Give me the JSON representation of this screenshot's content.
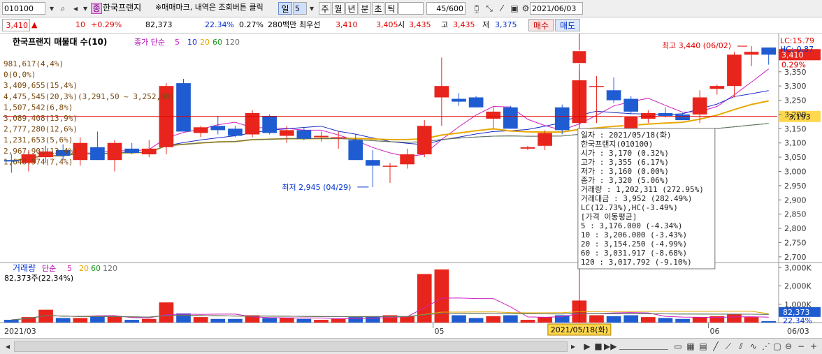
{
  "toolbar": {
    "code": "010100",
    "stock_name": "한국프랜지",
    "notice": "※매매마크, 내역은 조회버튼 클릭",
    "period_tabs": [
      "일",
      "주",
      "월",
      "년",
      "분",
      "초",
      "틱"
    ],
    "period_value": "5",
    "count_value": "45/600",
    "date_value": "2021/06/03"
  },
  "quote": {
    "price": "3,410",
    "change_arrow": "▲",
    "change": "10",
    "change_pct": "+0.29%",
    "volume": "82,373",
    "vol_ratio": "22.34%",
    "turnover": "0.27%",
    "amount": "280백만",
    "best_ask_label": "최우선",
    "best_ask": "3,410",
    "best_bid": "3,405",
    "open_label": "시",
    "open": "3,435",
    "high_label": "고",
    "high": "3,435",
    "low_label": "저",
    "low": "3,375",
    "buy_label": "매수",
    "sell_label": "매도"
  },
  "colors": {
    "up": "#e8251c",
    "down": "#1f5cd1",
    "ma5": "#d020c0",
    "ma10": "#1c2bc8",
    "ma20": "#e8a800",
    "ma60": "#18961c",
    "ma120": "#6e6e6e",
    "profile": "#f6e7d4"
  },
  "price_panel": {
    "title": "한국프랜지 매물대 수(10)",
    "ma_label": "종가 단순",
    "ma_periods": [
      "5",
      "10",
      "20",
      "60",
      "120"
    ],
    "lc_label": "LC:15.79",
    "hc_label": "HC:-0.87",
    "current_price_tag": "3,410",
    "current_pct_tag": "0.29%",
    "crosshair_price_tag": "3,193",
    "high_annot": "최고 3,440 (06/02)",
    "low_annot": "최저 2,945 (04/29)"
  },
  "volume_panel": {
    "title": "거래량",
    "ma_label": "단순",
    "ma_periods": [
      "5",
      "20",
      "60",
      "120"
    ],
    "subtitle": "82,373주(22,34%)",
    "value_tag": "82,373",
    "pct_tag": "22.34%"
  },
  "crosshair_date": "2021/05/18(화)",
  "tooltip": {
    "lines": [
      "일자       : 2021/05/18(화)",
      "한국프랜지(010100)",
      "  시가      : 3,170 (0.32%)",
      "  고가      : 3,355 (6.17%)",
      "  저가      : 3,160 (0.00%)",
      "  종가      : 3,320 (5.06%)",
      "  거래량    : 1,202,311 (272.95%)",
      "  거래대금  : 3,952 (282.49%)",
      "  LC(12.73%),HC(-3.49%)",
      "[가격 이동평균]",
      "  5         : 3,176.000 (-4.34%)",
      "  10        : 3,206.000 (-3.43%)",
      "  20        : 3,154.250 (-4.99%)",
      "  60        : 3,031.917 (-8.68%)",
      "  120       : 3,017.792 (-9.10%)"
    ]
  },
  "chart_data": {
    "type": "candlestick",
    "x_tick_labels": [
      "2021/03",
      "05",
      "06",
      "06/03"
    ],
    "y_axis": {
      "ticks": [
        3350,
        3300,
        3250,
        3200,
        3150,
        3100,
        3050,
        3000,
        2950,
        2900,
        2850,
        2800,
        2750,
        2700
      ],
      "tick_labels": [
        "3,350",
        "3,300",
        "3,250",
        "3,200",
        "3,150",
        "3,100",
        "3,050",
        "3,000",
        "2,950",
        "2,900",
        "2,850",
        "2,800",
        "2,750",
        "2,700"
      ],
      "range": [
        2680,
        3450
      ]
    },
    "volume_axis": {
      "ticks": [
        3000000,
        2000000,
        1000000
      ],
      "tick_labels": [
        "3,000K",
        "2,000K",
        "1,000K"
      ],
      "range": [
        0,
        3200000
      ]
    },
    "volume_profile": [
      {
        "label": "981,617(4,4%)",
        "length": 0.2
      },
      {
        "label": "0(0,0%)",
        "length": 0.0
      },
      {
        "label": "3,409,655(15,4%)",
        "length": 0.7
      },
      {
        "label": "4,475,545(20,3%)(3,291,50 ~ 3,252,00)",
        "length": 0.92
      },
      {
        "label": "1,507,542(6,8%)",
        "length": 0.31
      },
      {
        "label": "3,089,408(13,9%)",
        "length": 0.63
      },
      {
        "label": "2,777,280(12,6%)",
        "length": 0.57
      },
      {
        "label": "1,231,653(5,6%)",
        "length": 0.25
      },
      {
        "label": "2,967,901(13,4%)",
        "length": 0.61
      },
      {
        "label": "1,648,574(7,4%)",
        "length": 0.34
      }
    ],
    "candles": [
      {
        "o": 3040,
        "h": 3060,
        "l": 2995,
        "c": 3035,
        "v": 150000
      },
      {
        "o": 3030,
        "h": 3075,
        "l": 3000,
        "c": 3060,
        "v": 300000
      },
      {
        "o": 3050,
        "h": 3090,
        "l": 3030,
        "c": 3070,
        "v": 700000
      },
      {
        "o": 3075,
        "h": 3095,
        "l": 3040,
        "c": 3055,
        "v": 250000
      },
      {
        "o": 3040,
        "h": 3120,
        "l": 3020,
        "c": 3100,
        "v": 250000
      },
      {
        "o": 3085,
        "h": 3140,
        "l": 3040,
        "c": 3040,
        "v": 350000
      },
      {
        "o": 3040,
        "h": 3110,
        "l": 3000,
        "c": 3100,
        "v": 350000
      },
      {
        "o": 3080,
        "h": 3100,
        "l": 3060,
        "c": 3065,
        "v": 150000
      },
      {
        "o": 3060,
        "h": 3110,
        "l": 3050,
        "c": 3080,
        "v": 200000
      },
      {
        "o": 3085,
        "h": 3310,
        "l": 3060,
        "c": 3300,
        "v": 1100000
      },
      {
        "o": 3310,
        "h": 3325,
        "l": 3150,
        "c": 3140,
        "v": 500000
      },
      {
        "o": 3135,
        "h": 3160,
        "l": 3120,
        "c": 3155,
        "v": 300000
      },
      {
        "o": 3160,
        "h": 3195,
        "l": 3130,
        "c": 3145,
        "v": 200000
      },
      {
        "o": 3150,
        "h": 3160,
        "l": 3120,
        "c": 3125,
        "v": 200000
      },
      {
        "o": 3130,
        "h": 3215,
        "l": 3120,
        "c": 3205,
        "v": 400000
      },
      {
        "o": 3195,
        "h": 3200,
        "l": 3130,
        "c": 3135,
        "v": 250000
      },
      {
        "o": 3125,
        "h": 3160,
        "l": 3100,
        "c": 3145,
        "v": 250000
      },
      {
        "o": 3145,
        "h": 3155,
        "l": 3110,
        "c": 3115,
        "v": 200000
      },
      {
        "o": 3120,
        "h": 3140,
        "l": 3105,
        "c": 3125,
        "v": 150000
      },
      {
        "o": 3120,
        "h": 3140,
        "l": 3080,
        "c": 3120,
        "v": 200000
      },
      {
        "o": 3110,
        "h": 3130,
        "l": 3040,
        "c": 3040,
        "v": 300000
      },
      {
        "o": 3040,
        "h": 3075,
        "l": 2945,
        "c": 3020,
        "v": 350000
      },
      {
        "o": 3020,
        "h": 3030,
        "l": 2960,
        "c": 3020,
        "v": 400000
      },
      {
        "o": 3025,
        "h": 3080,
        "l": 3010,
        "c": 3060,
        "v": 350000
      },
      {
        "o": 3060,
        "h": 3180,
        "l": 3050,
        "c": 3160,
        "v": 2650000
      },
      {
        "o": 3260,
        "h": 3400,
        "l": 3160,
        "c": 3300,
        "v": 2900000
      },
      {
        "o": 3255,
        "h": 3275,
        "l": 3230,
        "c": 3245,
        "v": 400000
      },
      {
        "o": 3260,
        "h": 3265,
        "l": 3225,
        "c": 3225,
        "v": 250000
      },
      {
        "o": 3185,
        "h": 3225,
        "l": 3150,
        "c": 3210,
        "v": 350000
      },
      {
        "o": 3225,
        "h": 3230,
        "l": 3150,
        "c": 3150,
        "v": 400000
      },
      {
        "o": 3080,
        "h": 3090,
        "l": 3075,
        "c": 3085,
        "v": 150000
      },
      {
        "o": 3090,
        "h": 3145,
        "l": 3075,
        "c": 3135,
        "v": 300000
      },
      {
        "o": 3225,
        "h": 3235,
        "l": 3130,
        "c": 3145,
        "v": 400000
      },
      {
        "o": 3170,
        "h": 3355,
        "l": 3160,
        "c": 3320,
        "v": 1202311
      },
      {
        "o": 3300,
        "h": 3335,
        "l": 3170,
        "c": 3300,
        "v": 400000
      },
      {
        "o": 3285,
        "h": 3330,
        "l": 3240,
        "c": 3250,
        "v": 350000
      },
      {
        "o": 3255,
        "h": 3265,
        "l": 3200,
        "c": 3210,
        "v": 400000
      },
      {
        "o": 3185,
        "h": 3215,
        "l": 3170,
        "c": 3205,
        "v": 300000
      },
      {
        "o": 3205,
        "h": 3225,
        "l": 3190,
        "c": 3195,
        "v": 250000
      },
      {
        "o": 3200,
        "h": 3205,
        "l": 3180,
        "c": 3180,
        "v": 200000
      },
      {
        "o": 3200,
        "h": 3285,
        "l": 3170,
        "c": 3260,
        "v": 300000
      },
      {
        "o": 3290,
        "h": 3305,
        "l": 3270,
        "c": 3300,
        "v": 350000
      },
      {
        "o": 3300,
        "h": 3420,
        "l": 3260,
        "c": 3410,
        "v": 450000
      },
      {
        "o": 3410,
        "h": 3440,
        "l": 3370,
        "c": 3420,
        "v": 300000
      },
      {
        "o": 3435,
        "h": 3435,
        "l": 3375,
        "c": 3410,
        "v": 82373
      }
    ]
  }
}
